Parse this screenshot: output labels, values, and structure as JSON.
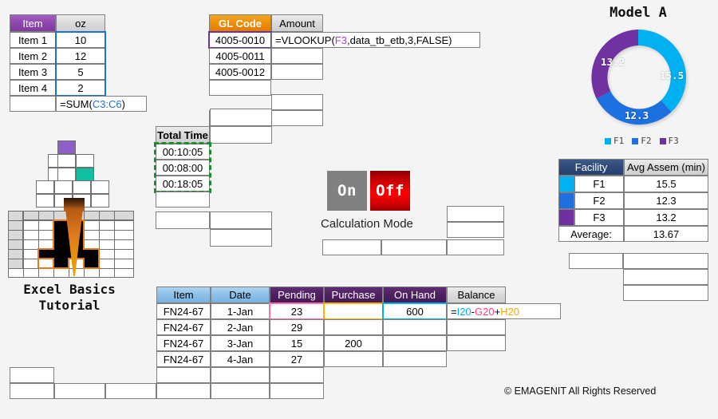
{
  "item_table": {
    "headers": [
      "Item",
      "oz"
    ],
    "rows": [
      {
        "item": "Item 1",
        "oz": "10"
      },
      {
        "item": "Item 2",
        "oz": "12"
      },
      {
        "item": "Item 3",
        "oz": "5"
      },
      {
        "item": "Item 4",
        "oz": "2"
      }
    ],
    "sum_formula": {
      "prefix": "=SUM(",
      "ref": "C3:C6",
      "suffix": ")"
    }
  },
  "gl_table": {
    "headers": [
      "GL Code",
      "Amount"
    ],
    "rows": [
      {
        "gl": "4005-0010"
      },
      {
        "gl": "4005-0011"
      },
      {
        "gl": "4005-0012"
      }
    ],
    "vlookup": {
      "p1": "=VLOOKUP(",
      "ref": "F3",
      "p2": ",data_tb_etb,3,FALSE)"
    }
  },
  "total_time": {
    "header": "Total Time",
    "values": [
      "00:10:05",
      "00:08:00",
      "00:18:05"
    ]
  },
  "calc_mode": {
    "on_label": "On",
    "off_label": "Off",
    "caption": "Calculation Mode"
  },
  "chart_data": {
    "type": "pie",
    "title": "Model A",
    "categories": [
      "F1",
      "F2",
      "F3"
    ],
    "values": [
      15.5,
      12.3,
      13.2
    ],
    "colors": [
      "#00b0f0",
      "#1f6fe0",
      "#7030a0"
    ],
    "labels": [
      "15.5",
      "12.3",
      "13.2"
    ],
    "legend": [
      "F1",
      "F2",
      "F3"
    ],
    "legend_position": "bottom",
    "donut": true,
    "xlabel": "",
    "ylabel": ""
  },
  "facility_table": {
    "headers": [
      "Facility",
      "Avg Assem (min)"
    ],
    "rows": [
      {
        "swatch": "#00b0f0",
        "facility": "F1",
        "avg": "15.5"
      },
      {
        "swatch": "#1f6fe0",
        "facility": "F2",
        "avg": "12.3"
      },
      {
        "swatch": "#7030a0",
        "facility": "F3",
        "avg": "13.2"
      }
    ],
    "footer_label": "Average:",
    "footer_value": "13.67"
  },
  "inventory_table": {
    "headers": [
      "Item",
      "Date",
      "Pending",
      "Purchase",
      "On Hand",
      "Balance"
    ],
    "rows": [
      {
        "item": "FN24-67",
        "date": "1-Jan",
        "pending": "23",
        "purchase": "",
        "onhand": "600"
      },
      {
        "item": "FN24-67",
        "date": "2-Jan",
        "pending": "29",
        "purchase": "",
        "onhand": ""
      },
      {
        "item": "FN24-67",
        "date": "3-Jan",
        "pending": "15",
        "purchase": "200",
        "onhand": ""
      },
      {
        "item": "FN24-67",
        "date": "4-Jan",
        "pending": "27",
        "purchase": "",
        "onhand": ""
      }
    ],
    "balance_formula": {
      "eq": "=",
      "r1": "I20",
      "op1": "-",
      "r2": "G20",
      "op2": "+",
      "r3": "H20"
    }
  },
  "logo": {
    "title_line1": "Excel Basics",
    "title_line2": "Tutorial",
    "pixel_colors": {
      "purple": "#8e5fc8",
      "teal": "#0fbfa0",
      "cyan": "#00e5ff",
      "orange": "#e07b1f",
      "black": "#000000",
      "grid_gray": "#d9d9d9"
    }
  },
  "footer": {
    "copyright": "© EMAGENIT All Rights Reserved"
  }
}
